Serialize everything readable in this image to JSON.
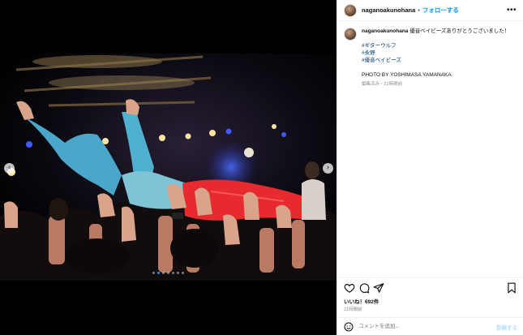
{
  "header": {
    "username": "naganoakunohana",
    "separator": "•",
    "follow_label": "フォローする",
    "more_label": "•••"
  },
  "caption": {
    "username": "naganoakunohana",
    "text": "優音ベイビーズありがとうございました！",
    "hashtags": [
      "#ギターウルフ",
      "#永野",
      "#優音ベイビーズ"
    ],
    "credit": "PHOTO BY YOSHIMASA YAMANAKA",
    "meta": "編集済み・21時間前"
  },
  "stats": {
    "likes": "いいね！692件",
    "time": "21時間前"
  },
  "comment": {
    "placeholder": "コメントを追加...",
    "post_label": "投稿する"
  },
  "carousel": {
    "prev_icon": "chevron-left-icon",
    "next_icon": "chevron-right-icon",
    "slide_count": 7,
    "active_slide": 2
  },
  "colors": {
    "follow_blue": "#0095f6",
    "hashtag_navy": "#00376b",
    "post_disabled": "#b2dffc"
  }
}
